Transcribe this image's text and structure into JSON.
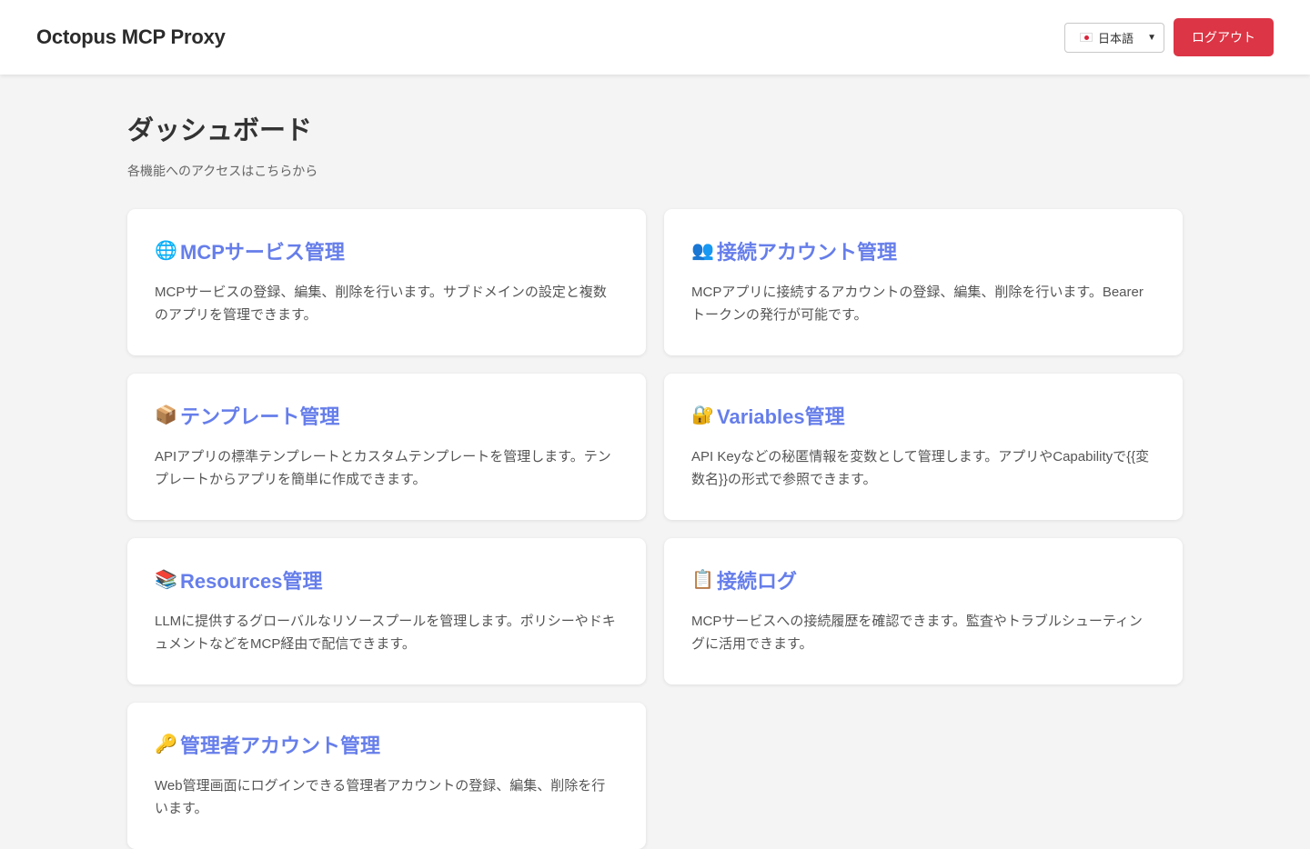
{
  "header": {
    "title": "Octopus MCP Proxy",
    "language": {
      "flag_icon": "japan-flag-icon",
      "selected": "日本語"
    },
    "logout_label": "ログアウト"
  },
  "page": {
    "title": "ダッシュボード",
    "subtitle": "各機能へのアクセスはこちらから"
  },
  "cards": [
    {
      "icon": "🌐",
      "title": "MCPサービス管理",
      "description": "MCPサービスの登録、編集、削除を行います。サブドメインの設定と複数のアプリを管理できます。"
    },
    {
      "icon": "👥",
      "title": "接続アカウント管理",
      "description": "MCPアプリに接続するアカウントの登録、編集、削除を行います。Bearerトークンの発行が可能です。"
    },
    {
      "icon": "📦",
      "title": "テンプレート管理",
      "description": "APIアプリの標準テンプレートとカスタムテンプレートを管理します。テンプレートからアプリを簡単に作成できます。"
    },
    {
      "icon": "🔐",
      "title": "Variables管理",
      "description": "API Keyなどの秘匿情報を変数として管理します。アプリやCapabilityで{{変数名}}の形式で参照できます。"
    },
    {
      "icon": "📚",
      "title": "Resources管理",
      "description": "LLMに提供するグローバルなリソースプールを管理します。ポリシーやドキュメントなどをMCP経由で配信できます。"
    },
    {
      "icon": "📋",
      "title": "接続ログ",
      "description": "MCPサービスへの接続履歴を確認できます。監査やトラブルシューティングに活用できます。"
    },
    {
      "icon": "🔑",
      "title": "管理者アカウント管理",
      "description": "Web管理画面にログインできる管理者アカウントの登録、編集、削除を行います。"
    }
  ],
  "colors": {
    "accent": "#667eea",
    "logout": "#dc3545",
    "background": "#f4f4f4"
  }
}
